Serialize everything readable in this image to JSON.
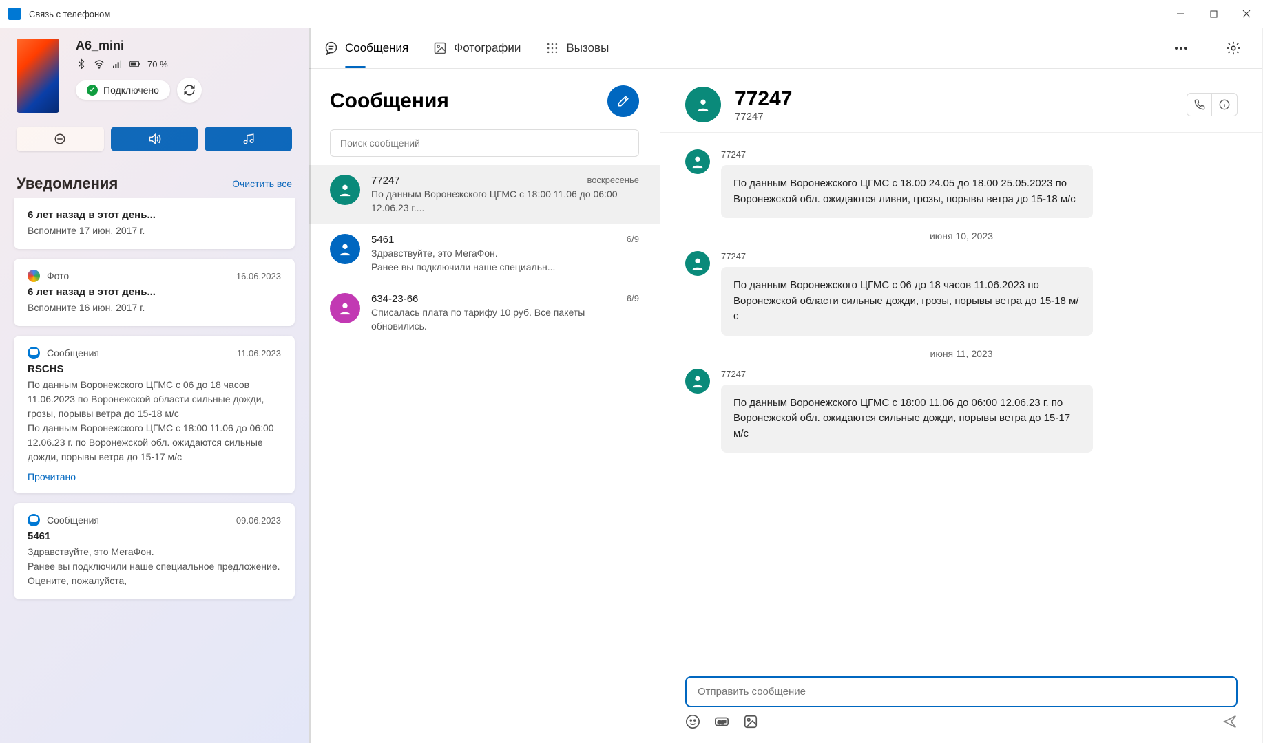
{
  "titlebar": {
    "title": "Связь с телефоном"
  },
  "device": {
    "name": "A6_mini",
    "battery": "70 %",
    "connected_label": "Подключено"
  },
  "notifications": {
    "heading": "Уведомления",
    "clear_all": "Очистить все",
    "items": [
      {
        "title": "6 лет назад в этот день...",
        "sub": "Вспомните 17 июн. 2017 г."
      },
      {
        "app": "Фото",
        "date": "16.06.2023",
        "title": "6 лет назад в этот день...",
        "sub": "Вспомните 16 июн. 2017 г."
      },
      {
        "app": "Сообщения",
        "date": "11.06.2023",
        "title": "RSCHS",
        "sub": "По данным Воронежского ЦГМС с 06 до 18 часов 11.06.2023 по Воронежской области сильные дожди, грозы, порывы ветра до 15-18 м/с\nПо данным Воронежского ЦГМС с 18:00 11.06 до 06:00 12.06.23 г. по Воронежской обл. ожидаются сильные дожди, порывы ветра до 15-17 м/с",
        "action": "Прочитано"
      },
      {
        "app": "Сообщения",
        "date": "09.06.2023",
        "title": "5461",
        "sub": "Здравствуйте, это МегаФон.\nРанее вы подключили наше специальное предложение. Оцените, пожалуйста,"
      }
    ]
  },
  "tabs": {
    "messages": "Сообщения",
    "photos": "Фотографии",
    "calls": "Вызовы"
  },
  "messages": {
    "heading": "Сообщения",
    "search_placeholder": "Поиск сообщений",
    "conversations": [
      {
        "name": "77247",
        "time": "воскресенье",
        "preview": "По данным Воронежского ЦГМС с 18:00 11.06 до 06:00 12.06.23 г...."
      },
      {
        "name": "5461",
        "time": "6/9",
        "preview": "Здравствуйте, это МегаФон.\nРанее вы подключили наше специальн..."
      },
      {
        "name": "634-23-66",
        "time": "6/9",
        "preview": "Списалась плата по тарифу 10 руб. Все пакеты обновились."
      }
    ]
  },
  "chat": {
    "title": "77247",
    "subtitle": "77247",
    "compose_placeholder": "Отправить сообщение",
    "blocks": [
      {
        "type": "msg",
        "sender": "77247",
        "text": "По данным Воронежского ЦГМС с 18.00 24.05 до 18.00 25.05.2023 по Воронежской обл. ожидаются ливни, грозы, порывы ветра  до 15-18 м/с"
      },
      {
        "type": "date",
        "text": "июня 10, 2023"
      },
      {
        "type": "msg",
        "sender": "77247",
        "text": "По данным Воронежского ЦГМС с 06 до 18 часов 11.06.2023 по Воронежской области сильные дожди, грозы, порывы ветра до 15-18 м/с"
      },
      {
        "type": "date",
        "text": "июня 11, 2023"
      },
      {
        "type": "msg",
        "sender": "77247",
        "text": "По данным Воронежского ЦГМС с 18:00 11.06 до 06:00 12.06.23 г. по Воронежской обл. ожидаются сильные дожди, порывы ветра до 15-17 м/с"
      }
    ]
  }
}
